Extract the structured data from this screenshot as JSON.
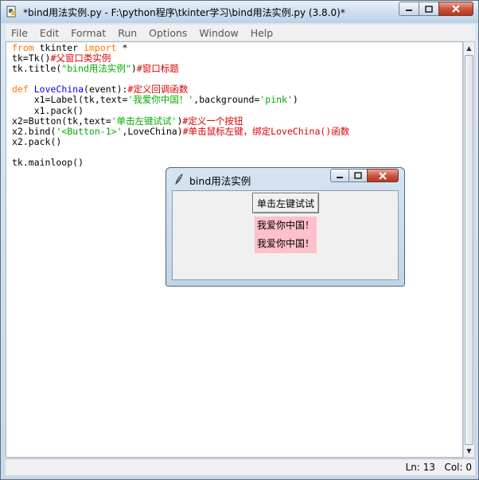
{
  "window": {
    "title": "*bind用法实例.py - F:\\python程序\\tkinter学习\\bind用法实例.py (3.8.0)*"
  },
  "menu": [
    "File",
    "Edit",
    "Format",
    "Run",
    "Options",
    "Window",
    "Help"
  ],
  "editor": {
    "lines": [
      [
        {
          "t": "from",
          "c": "kw"
        },
        {
          "t": " tkinter "
        },
        {
          "t": "import",
          "c": "kw"
        },
        {
          "t": " *"
        }
      ],
      [
        {
          "t": "tk=Tk()"
        },
        {
          "t": "#父窗口类实例",
          "c": "cm"
        }
      ],
      [
        {
          "t": "tk.title("
        },
        {
          "t": "\"bind用法实例\"",
          "c": "str"
        },
        {
          "t": ")"
        },
        {
          "t": "#窗口标题",
          "c": "cm"
        }
      ],
      [],
      [
        {
          "t": "def",
          "c": "kw"
        },
        {
          "t": " "
        },
        {
          "t": "LoveChina",
          "c": "fn"
        },
        {
          "t": "(event):"
        },
        {
          "t": "#定义回调函数",
          "c": "cm"
        }
      ],
      [
        {
          "t": "    x1=Label(tk,text="
        },
        {
          "t": "'我爱你中国！'",
          "c": "str"
        },
        {
          "t": ",background="
        },
        {
          "t": "'pink'",
          "c": "str"
        },
        {
          "t": ")"
        }
      ],
      [
        {
          "t": "    x1.pack()"
        }
      ],
      [
        {
          "t": "x2=Button(tk,text="
        },
        {
          "t": "'单击左键试试'",
          "c": "str"
        },
        {
          "t": ")"
        },
        {
          "t": "#定义一个按钮",
          "c": "cm"
        }
      ],
      [
        {
          "t": "x2.bind("
        },
        {
          "t": "'<Button-1>'",
          "c": "str"
        },
        {
          "t": ",LoveChina)"
        },
        {
          "t": "#单击鼠标左键，绑定LoveChina()函数",
          "c": "cm"
        }
      ],
      [
        {
          "t": "x2.pack()"
        }
      ],
      [],
      [
        {
          "t": "tk.mainloop()"
        }
      ]
    ]
  },
  "status": {
    "line": "Ln: 13",
    "col": "Col: 0"
  },
  "tk_window": {
    "title": "bind用法实例",
    "button_label": "单击左键试试",
    "labels": [
      "我爱你中国！",
      "我爱你中国！"
    ],
    "label_bg": "#ffc0cb"
  },
  "icons": {
    "app": "python-idle-icon",
    "tk": "tk-feather-icon",
    "minimize": "minimize-icon",
    "maximize": "maximize-icon",
    "close": "close-icon"
  }
}
